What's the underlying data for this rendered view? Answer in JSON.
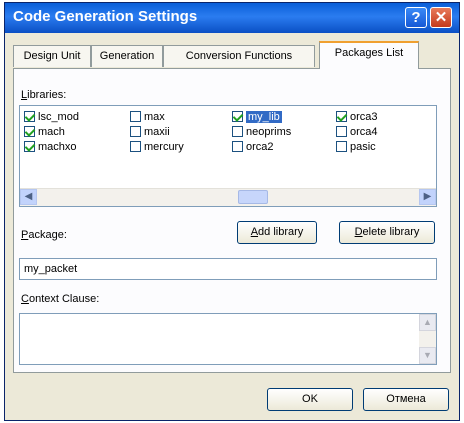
{
  "window": {
    "title": "Code Generation Settings"
  },
  "tabs": [
    {
      "label": "Design Unit"
    },
    {
      "label": "Generation"
    },
    {
      "label": "Conversion Functions"
    },
    {
      "label": "Packages List"
    }
  ],
  "libraries": {
    "label_accel": "L",
    "label_rest": "ibraries:",
    "items": [
      {
        "name": "lsc_mod",
        "checked": true
      },
      {
        "name": "max",
        "checked": false
      },
      {
        "name": "my_lib",
        "checked": true,
        "selected": true
      },
      {
        "name": "orca3",
        "checked": true
      },
      {
        "name": "mach",
        "checked": true
      },
      {
        "name": "maxii",
        "checked": false
      },
      {
        "name": "neoprims",
        "checked": false
      },
      {
        "name": "orca4",
        "checked": false
      },
      {
        "name": "machxo",
        "checked": true
      },
      {
        "name": "mercury",
        "checked": false
      },
      {
        "name": "orca2",
        "checked": false
      },
      {
        "name": "pasic",
        "checked": false
      }
    ]
  },
  "buttons": {
    "add_library_accel": "A",
    "add_library_rest": "dd library",
    "delete_library_accel": "D",
    "delete_library_rest": "elete library",
    "ok": "OK",
    "cancel": "Отмена"
  },
  "package": {
    "label_accel": "P",
    "label_rest": "ackage:",
    "value": "my_packet"
  },
  "context_clause": {
    "label_accel": "C",
    "label_rest": "ontext Clause:",
    "value": ""
  },
  "colors": {
    "titlebar": "#0a5fd8",
    "selection": "#316ac5",
    "dialog_bg": "#ece9d8"
  },
  "icons": [
    "help-icon",
    "close-icon",
    "scroll-left-icon",
    "scroll-right-icon",
    "scroll-up-icon",
    "scroll-down-icon"
  ]
}
